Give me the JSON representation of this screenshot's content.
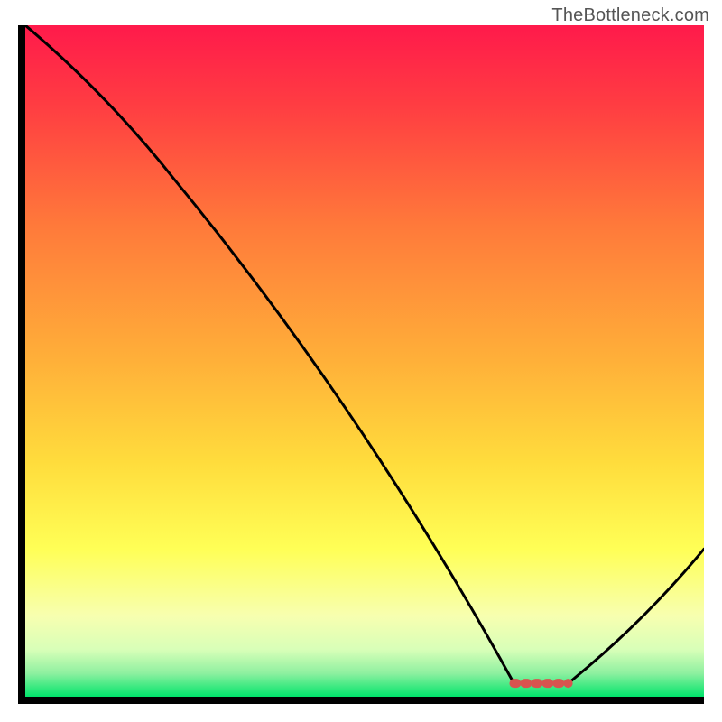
{
  "watermark": "TheBottleneck.com",
  "chart_data": {
    "type": "line",
    "title": "",
    "xlabel": "",
    "ylabel": "",
    "xlim": [
      0,
      100
    ],
    "ylim": [
      0,
      100
    ],
    "grid": false,
    "series": [
      {
        "name": "curve",
        "x": [
          0,
          22,
          72,
          80,
          100
        ],
        "y": [
          100,
          77,
          2,
          2,
          22
        ],
        "note": "y is % height from bottom; curve descends steeply, flat minimum ~72–80%, then rises to right edge"
      }
    ],
    "marker": {
      "name": "optimal-range",
      "x_start": 72,
      "x_end": 80,
      "y": 2,
      "color": "#d9534f",
      "style": "dashed"
    },
    "background_gradient": {
      "stops": [
        {
          "pos": 0.0,
          "color": "#ff1a4b"
        },
        {
          "pos": 0.12,
          "color": "#ff3d42"
        },
        {
          "pos": 0.3,
          "color": "#ff7a3a"
        },
        {
          "pos": 0.5,
          "color": "#ffb039"
        },
        {
          "pos": 0.65,
          "color": "#ffdc3c"
        },
        {
          "pos": 0.78,
          "color": "#ffff56"
        },
        {
          "pos": 0.88,
          "color": "#f7ffb0"
        },
        {
          "pos": 0.93,
          "color": "#d8ffb8"
        },
        {
          "pos": 0.965,
          "color": "#8ef0a0"
        },
        {
          "pos": 1.0,
          "color": "#00e46b"
        }
      ],
      "direction": "top-to-bottom"
    }
  }
}
